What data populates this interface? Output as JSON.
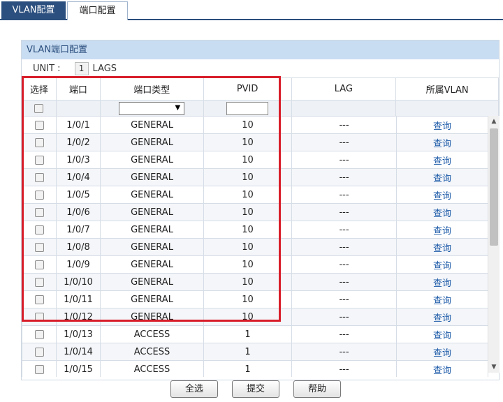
{
  "tabs": [
    {
      "label": "VLAN配置",
      "active": false
    },
    {
      "label": "端口配置",
      "active": true
    }
  ],
  "panel": {
    "title": "VLAN端口配置",
    "unit_label": "UNIT :",
    "unit_value": "1",
    "lags_label": "LAGS"
  },
  "table": {
    "headers": [
      "选择",
      "端口",
      "端口类型",
      "PVID",
      "LAG",
      "所属VLAN"
    ],
    "filter": {
      "type_selected": "",
      "pvid_value": ""
    },
    "rows": [
      {
        "port": "1/0/1",
        "type": "GENERAL",
        "pvid": "10",
        "lag": "---",
        "vlan_link": "查询"
      },
      {
        "port": "1/0/2",
        "type": "GENERAL",
        "pvid": "10",
        "lag": "---",
        "vlan_link": "查询"
      },
      {
        "port": "1/0/3",
        "type": "GENERAL",
        "pvid": "10",
        "lag": "---",
        "vlan_link": "查询"
      },
      {
        "port": "1/0/4",
        "type": "GENERAL",
        "pvid": "10",
        "lag": "---",
        "vlan_link": "查询"
      },
      {
        "port": "1/0/5",
        "type": "GENERAL",
        "pvid": "10",
        "lag": "---",
        "vlan_link": "查询"
      },
      {
        "port": "1/0/6",
        "type": "GENERAL",
        "pvid": "10",
        "lag": "---",
        "vlan_link": "查询"
      },
      {
        "port": "1/0/7",
        "type": "GENERAL",
        "pvid": "10",
        "lag": "---",
        "vlan_link": "查询"
      },
      {
        "port": "1/0/8",
        "type": "GENERAL",
        "pvid": "10",
        "lag": "---",
        "vlan_link": "查询"
      },
      {
        "port": "1/0/9",
        "type": "GENERAL",
        "pvid": "10",
        "lag": "---",
        "vlan_link": "查询"
      },
      {
        "port": "1/0/10",
        "type": "GENERAL",
        "pvid": "10",
        "lag": "---",
        "vlan_link": "查询"
      },
      {
        "port": "1/0/11",
        "type": "GENERAL",
        "pvid": "10",
        "lag": "---",
        "vlan_link": "查询"
      },
      {
        "port": "1/0/12",
        "type": "GENERAL",
        "pvid": "10",
        "lag": "---",
        "vlan_link": "查询"
      },
      {
        "port": "1/0/13",
        "type": "ACCESS",
        "pvid": "1",
        "lag": "---",
        "vlan_link": "查询"
      },
      {
        "port": "1/0/14",
        "type": "ACCESS",
        "pvid": "1",
        "lag": "---",
        "vlan_link": "查询"
      },
      {
        "port": "1/0/15",
        "type": "ACCESS",
        "pvid": "1",
        "lag": "---",
        "vlan_link": "查询"
      }
    ]
  },
  "buttons": {
    "select_all": "全选",
    "submit": "提交",
    "help": "帮助"
  },
  "colors": {
    "tab_active_bg": "#2b4f7e",
    "panel_title_bg": "#c9ddf2",
    "highlight_border": "#d81e2a",
    "link": "#1c5aa8"
  }
}
